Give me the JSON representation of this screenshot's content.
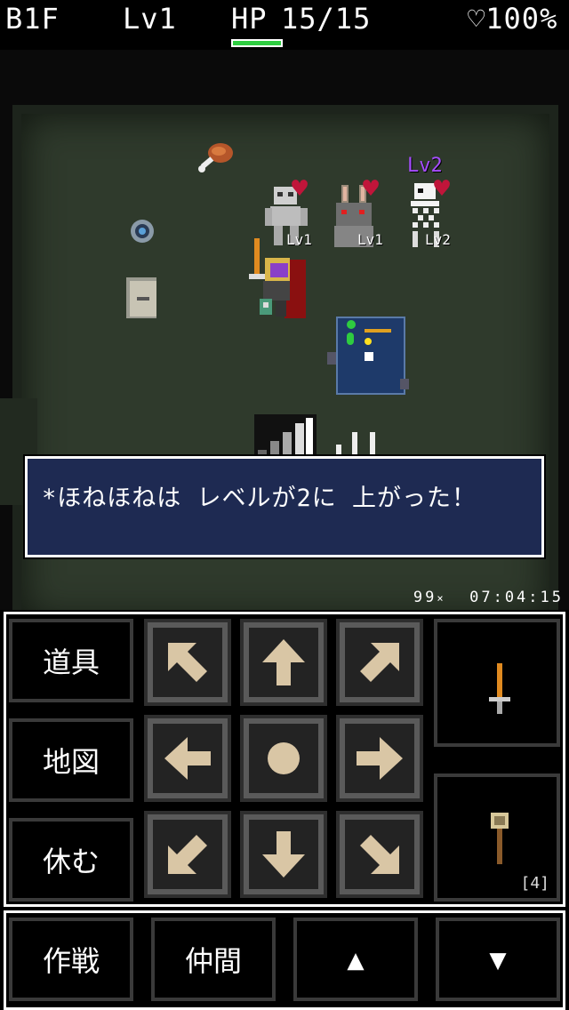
{
  "status": {
    "floor": "B1F",
    "level": "Lv1",
    "hp_label": "HP",
    "hp_value": "15/15",
    "hp_fill": 1.0,
    "happiness": "♡100%"
  },
  "map": {
    "monsters": [
      {
        "name": "skeleton-warrior",
        "level": "Lv1"
      },
      {
        "name": "rabbit",
        "level": "Lv1"
      },
      {
        "name": "bone-creature",
        "level": "Lv2",
        "label_above": "Lv2"
      }
    ],
    "hud": {
      "counter": "99",
      "counter_suffix": "×",
      "time": "07:04:15"
    }
  },
  "message": {
    "text": "*ほねほねは レベルが2に 上がった！"
  },
  "controls": {
    "left_commands": [
      "道具",
      "地図",
      "休む"
    ],
    "bottom_commands": [
      "作戦",
      "仲間",
      "▲",
      "▼"
    ],
    "directions": [
      "up-left",
      "up",
      "up-right",
      "left",
      "wait",
      "right",
      "down-left",
      "down",
      "down-right"
    ],
    "item_slot_count": "[4]"
  },
  "colors": {
    "hp_bar": "#2ecc40",
    "message_bg": "#1e2a52",
    "arrow": "#d9c6a5",
    "level2_tag": "#a64dff"
  }
}
